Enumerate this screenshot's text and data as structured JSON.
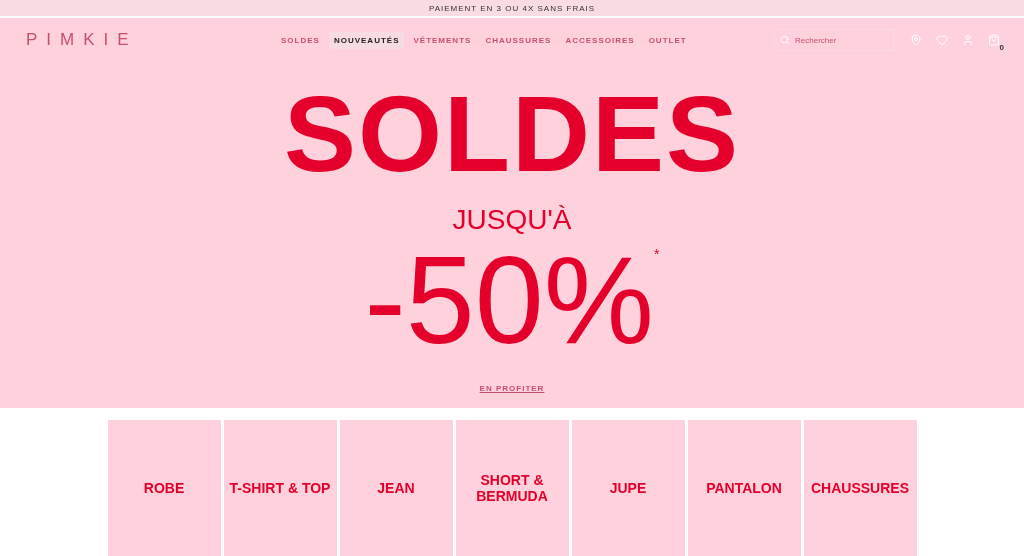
{
  "promo_bar": {
    "text": "PAIEMENT EN 3 OU 4X SANS FRAIS"
  },
  "header": {
    "logo": "PIMKIE",
    "nav": [
      {
        "label": "SOLDES",
        "selected": false
      },
      {
        "label": "NOUVEAUTÉS",
        "selected": true
      },
      {
        "label": "VÊTEMENTS",
        "selected": false
      },
      {
        "label": "CHAUSSURES",
        "selected": false
      },
      {
        "label": "ACCESSOIRES",
        "selected": false
      },
      {
        "label": "OUTLET",
        "selected": false
      }
    ],
    "search": {
      "placeholder": "Rechercher"
    },
    "cart_count": "0"
  },
  "hero": {
    "title": "SOLDES",
    "subtitle": "JUSQU'À",
    "discount": "-50%",
    "footnote_mark": "*",
    "cta": "EN PROFITER"
  },
  "categories": [
    {
      "label": "ROBE"
    },
    {
      "label": "T-SHIRT & TOP"
    },
    {
      "label": "JEAN"
    },
    {
      "label": "SHORT & BERMUDA"
    },
    {
      "label": "JUPE"
    },
    {
      "label": "PANTALON"
    },
    {
      "label": "CHAUSSURES"
    }
  ]
}
